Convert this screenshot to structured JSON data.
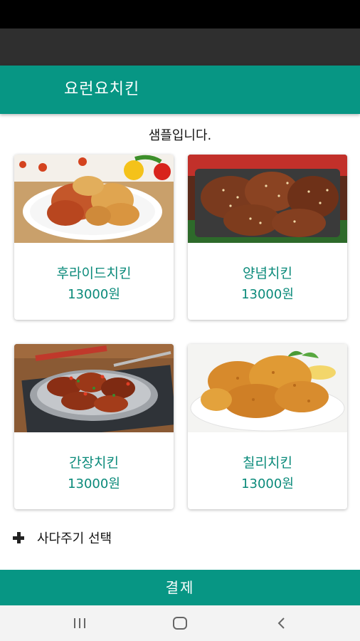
{
  "app": {
    "title": "요런요치킨",
    "subtitle": "샘플입니다."
  },
  "menu": [
    {
      "name": "후라이드치킨",
      "price": "13000원",
      "image": "fried-chicken-photo"
    },
    {
      "name": "양념치킨",
      "price": "13000원",
      "image": "sesame-sauced-chicken-photo"
    },
    {
      "name": "간장치킨",
      "price": "13000원",
      "image": "soy-chicken-photo"
    },
    {
      "name": "칠리치킨",
      "price": "13000원",
      "image": "chili-chicken-photo"
    }
  ],
  "addon": {
    "label": "사다주기 선택",
    "icon": "plus-icon"
  },
  "footer": {
    "pay_label": "결제"
  },
  "nav": {
    "icons": [
      "recent-apps-icon",
      "home-icon",
      "back-icon"
    ]
  },
  "colors": {
    "primary": "#079684",
    "accent_text": "#0a8a7a"
  }
}
